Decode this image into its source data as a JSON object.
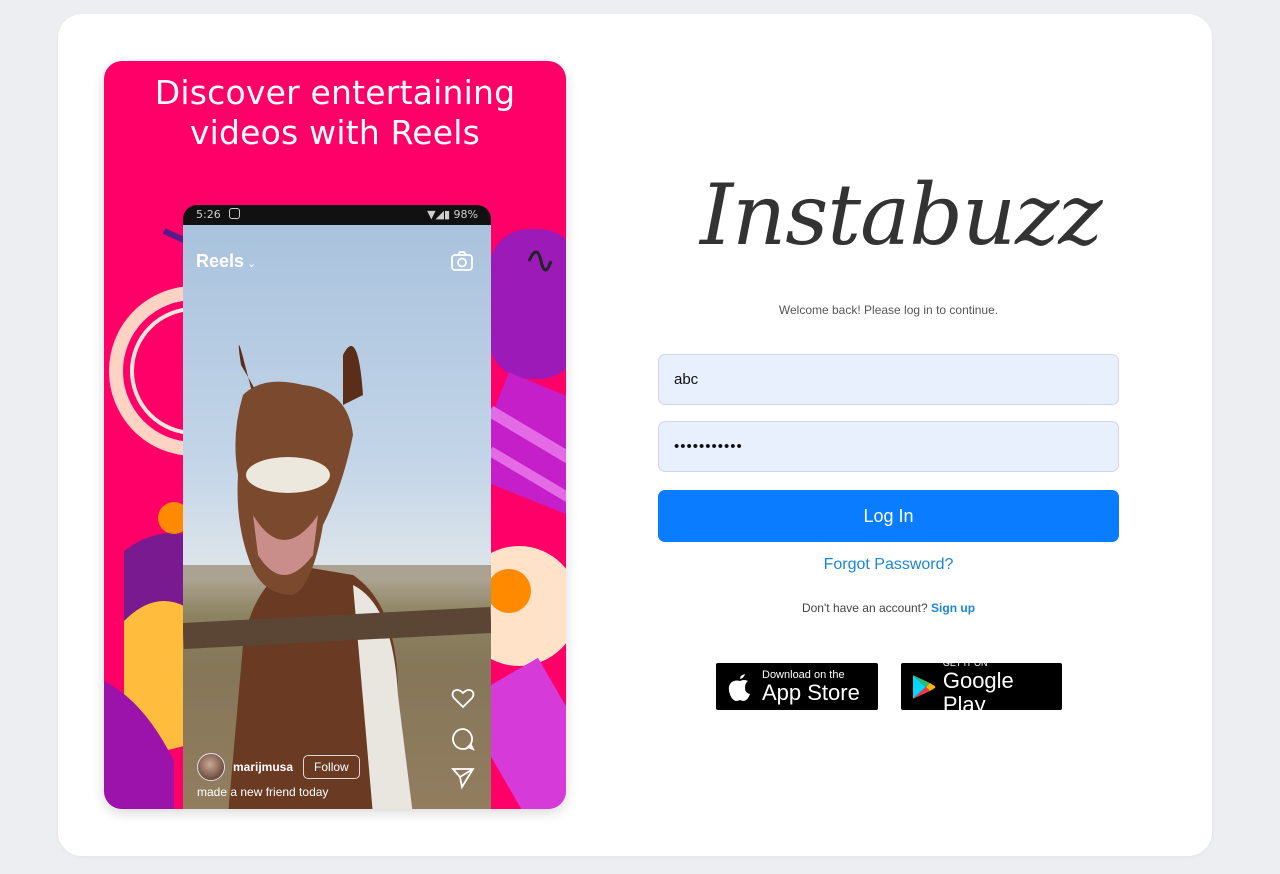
{
  "promo": {
    "title": "Discover entertaining videos with Reels",
    "phone": {
      "status_time": "5:26",
      "status_right": "98%",
      "reels_label": "Reels",
      "username": "marijmusa",
      "follow_label": "Follow",
      "caption": "made a new friend today"
    }
  },
  "brand": {
    "logo_text": "Instabuzz"
  },
  "login": {
    "welcome": "Welcome back! Please log in to continue.",
    "username_value": "abc",
    "password_value": "•••••••••••",
    "login_label": "Log In",
    "forgot_label": "Forgot Password?",
    "no_account_text": "Don't have an account?",
    "signup_label": "Sign up"
  },
  "stores": {
    "app_store_small": "Download on the",
    "app_store_big": "App Store",
    "google_small": "GET IT ON",
    "google_big": "Google Play"
  },
  "colors": {
    "promo_bg": "#ff0069",
    "primary_button": "#0a7cff",
    "link": "#1a86d6",
    "input_bg": "#e8f0fe"
  }
}
